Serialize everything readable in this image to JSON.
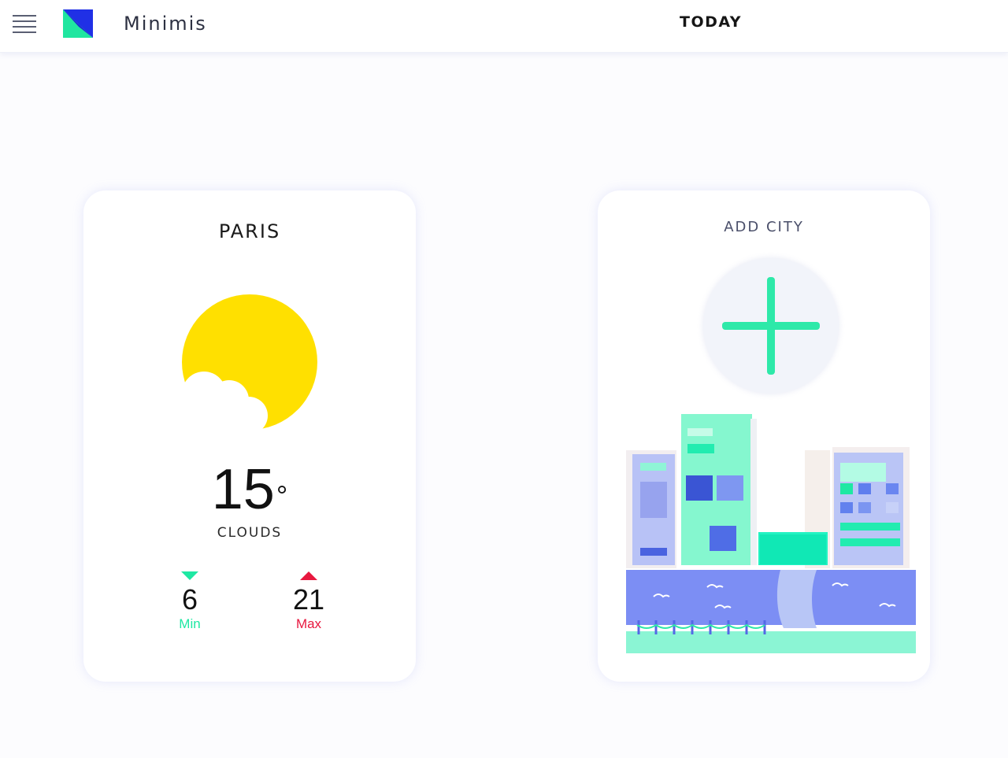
{
  "header": {
    "brand": "Minimis",
    "nav_today": "TODAY"
  },
  "weather_card": {
    "city": "PARIS",
    "temperature": "15",
    "degree_symbol": "°",
    "condition": "CLOUDS",
    "min": {
      "value": "6",
      "label": "Min"
    },
    "max": {
      "value": "21",
      "label": "Max"
    },
    "icon": "sun-behind-cloud-icon"
  },
  "add_city_card": {
    "title": "ADD CITY",
    "icon": "plus-icon"
  },
  "colors": {
    "sun": "#ffe000",
    "min_accent": "#1ee8a3",
    "max_accent": "#e8183f",
    "plus": "#2ee9a9",
    "logo_green": "#20e6a0",
    "logo_blue": "#2030e6"
  }
}
